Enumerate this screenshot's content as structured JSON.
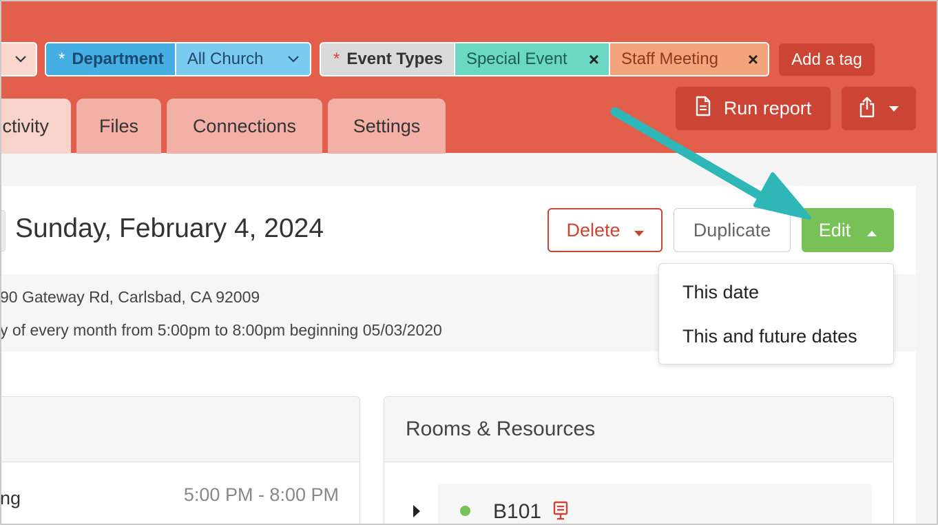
{
  "filters": {
    "tag1": {
      "chevron_icon": "chevron-down-icon"
    },
    "department": {
      "required_mark": "*",
      "label": "Department",
      "value": "All Church"
    },
    "event_types": {
      "required_mark": "*",
      "label": "Event Types",
      "tags": [
        "Special Event",
        "Staff Meeting"
      ],
      "remove_icon": "×"
    },
    "add_tag_label": "Add a tag"
  },
  "tabs": [
    {
      "label": "ctivity"
    },
    {
      "label": "Files"
    },
    {
      "label": "Connections"
    },
    {
      "label": "Settings"
    }
  ],
  "toolbar": {
    "run_report_label": "Run report",
    "share_icon": "share-icon"
  },
  "event": {
    "date_title": "Sunday, February 4, 2024",
    "address": "90 Gateway Rd, Carlsbad, CA 92009",
    "recurrence": "y of every month from 5:00pm to 8:00pm beginning 05/03/2020"
  },
  "actions": {
    "delete_label": "Delete",
    "duplicate_label": "Duplicate",
    "edit_label": "Edit"
  },
  "edit_menu": {
    "items": [
      "This date",
      "This and future dates"
    ]
  },
  "schedule": {
    "name": "ng",
    "time": "5:00 PM - 8:00 PM"
  },
  "resources": {
    "title": "Rooms & Resources",
    "rooms": [
      {
        "name": "B101",
        "status_color": "#78c157"
      }
    ]
  },
  "colors": {
    "header": "#e25f4b",
    "accent_red": "#cc4434",
    "edit_green": "#78c157",
    "arrow_teal": "#2fb6b6"
  }
}
